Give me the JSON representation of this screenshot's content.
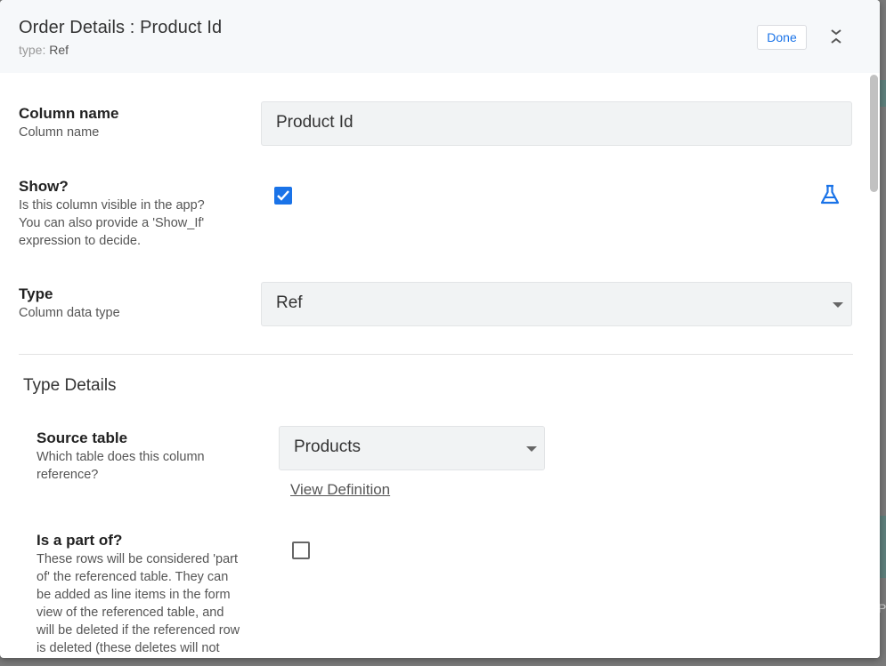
{
  "header": {
    "title": "Order Details : Product Id",
    "type_label": "type:",
    "type_value": "Ref",
    "done_label": "Done"
  },
  "column_name": {
    "label": "Column name",
    "description": "Column name",
    "value": "Product Id"
  },
  "show": {
    "label": "Show?",
    "description_lines": [
      "Is this column visible in the app?",
      "You can also provide a 'Show_If'",
      "expression to decide."
    ],
    "checked": true
  },
  "type": {
    "label": "Type",
    "description": "Column data type",
    "value": "Ref"
  },
  "type_details": {
    "section_title": "Type Details",
    "source_table": {
      "label": "Source table",
      "description_lines": [
        "Which table does this column",
        "reference?"
      ],
      "value": "Products",
      "link_label": "View Definition"
    },
    "is_part_of": {
      "label": "Is a part of?",
      "description_lines": [
        "These rows will be considered 'part",
        "of' the referenced table. They can",
        "be added as line items in the form",
        "view of the referenced table, and",
        "will be deleted if the referenced row",
        "is deleted (these deletes will not"
      ],
      "checked": false
    }
  },
  "background": {
    "fragment": "Pr"
  },
  "colors": {
    "accent": "#1a73e8",
    "header_bg": "#f6f8fa",
    "field_bg": "#f1f3f4"
  }
}
